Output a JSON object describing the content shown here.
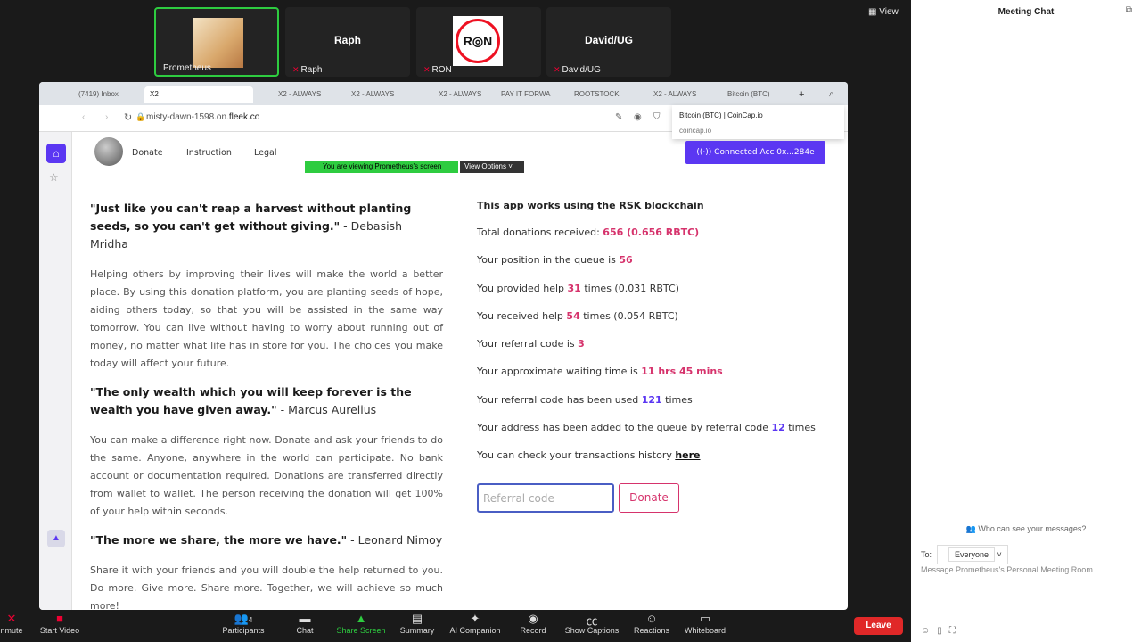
{
  "meeting": {
    "participants": [
      {
        "label": "Prometheus",
        "name": ""
      },
      {
        "label": "Raph",
        "name": "Raph"
      },
      {
        "label": "RON",
        "name": ""
      },
      {
        "label": "David/UG",
        "name": "David/UG"
      }
    ],
    "view_label": "View",
    "sharing_notice": "You are viewing Prometheus's screen",
    "view_options": "View Options"
  },
  "browser": {
    "tabs": [
      "(7419) Inbox",
      "X2",
      "X2 - ALWAYS",
      "X2 - ALWAYS",
      "X2 - ALWAYS",
      "PAY IT FORWA",
      "ROOTSTOCK",
      "X2 - ALWAYS",
      "Bitcoin (BTC)"
    ],
    "url_prefix": "misty-dawn-1598.on.",
    "url_domain": "fleek.co",
    "tooltip_title": "Bitcoin (BTC) | CoinCap.io",
    "tooltip_domain": "coincap.io"
  },
  "nav": {
    "links": [
      "Donate",
      "Instruction",
      "Legal"
    ],
    "connected": "Connected Acc 0x...284e"
  },
  "left": {
    "quote1": "\"Just like you can't reap a harvest without planting seeds, so you can't get without giving.\"",
    "author1": " - Debasish Mridha",
    "para1": "Helping others by improving their lives will make the world a better place. By using this donation platform, you are planting seeds of hope, aiding others today, so that you will be assisted in the same way tomorrow. You can live without having to worry about running out of money, no matter what life has in store for you. The choices you make today will affect your future.",
    "quote2": "\"The only wealth which you will keep forever is the wealth you have given away.\"",
    "author2": " - Marcus Aurelius",
    "para2": "You can make a difference right now. Donate and ask your friends to do the same. Anyone, anywhere in the world can participate. No bank account or documentation required. Donations are transferred directly from wallet to wallet. The person receiving the donation will get 100% of your help within seconds.",
    "quote3": "\"The more we share, the more we have.\"",
    "author3": " - Leonard Nimoy",
    "para3": "Share it with your friends and you will double the help returned to you. Do more. Give more. Share more. Together, we will achieve so much more!"
  },
  "right": {
    "title": "This app works using the RSK blockchain",
    "total_label": "Total donations received: ",
    "total_value": "656 (0.656 RBTC)",
    "position_label": "Your position in the queue is ",
    "position_value": "56",
    "provided_label": "You provided help ",
    "provided_value": "31",
    "provided_suffix": " times (0.031 RBTC)",
    "received_label": "You received help ",
    "received_value": "54",
    "received_suffix": " times (0.054 RBTC)",
    "refcode_label": "Your referral code is ",
    "refcode_value": "3",
    "wait_label": "Your approximate waiting time is ",
    "wait_value": "11 hrs 45 mins",
    "used_label": "Your referral code has been used ",
    "used_value": "121",
    "used_suffix": " times",
    "added_label": "Your address has been added to the queue by referral code ",
    "added_value": "12",
    "added_suffix": " times",
    "history_label": "You can check your transactions history ",
    "history_link": "here",
    "ref_placeholder": "Referral code",
    "donate_button": "Donate"
  },
  "chat": {
    "title": "Meeting Chat",
    "who_can_see": "Who can see your messages?",
    "to_label": "To:",
    "to_value": "Everyone",
    "placeholder": "Message Prometheus's Personal Meeting Room"
  },
  "toolbar": {
    "items": [
      "nmute",
      "Start Video",
      "Participants",
      "Chat",
      "Share Screen",
      "Summary",
      "AI Companion",
      "Record",
      "Show Captions",
      "Reactions",
      "Whiteboard"
    ],
    "participant_count": "4",
    "leave": "Leave"
  }
}
